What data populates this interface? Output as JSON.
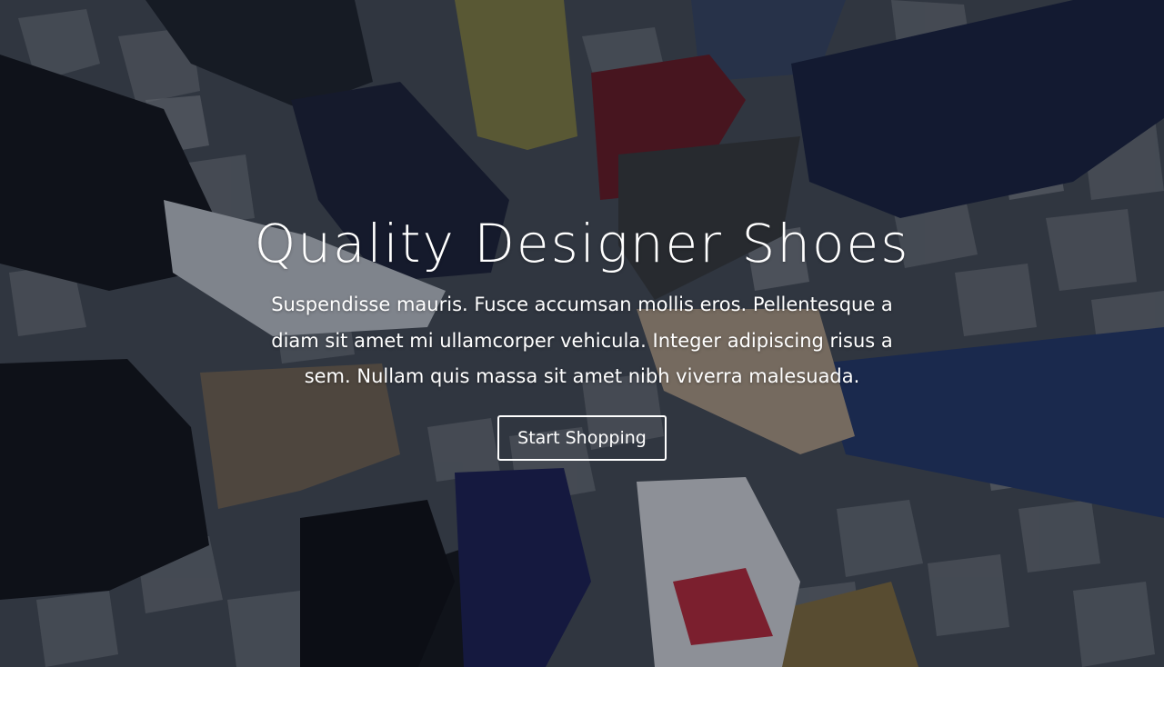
{
  "hero": {
    "title": "Quality Designer Shoes",
    "text": "Suspendisse mauris. Fusce accumsan mollis eros. Pellentesque a diam sit amet mi ullamcorper vehicula. Integer adipiscing risus a sem. Nullam quis massa sit amet nibh viverra malesuada.",
    "button_label": "Start Shopping"
  },
  "colors": {
    "text": "#ffffff",
    "button_border": "#ffffff",
    "page_background": "#ffffff"
  }
}
